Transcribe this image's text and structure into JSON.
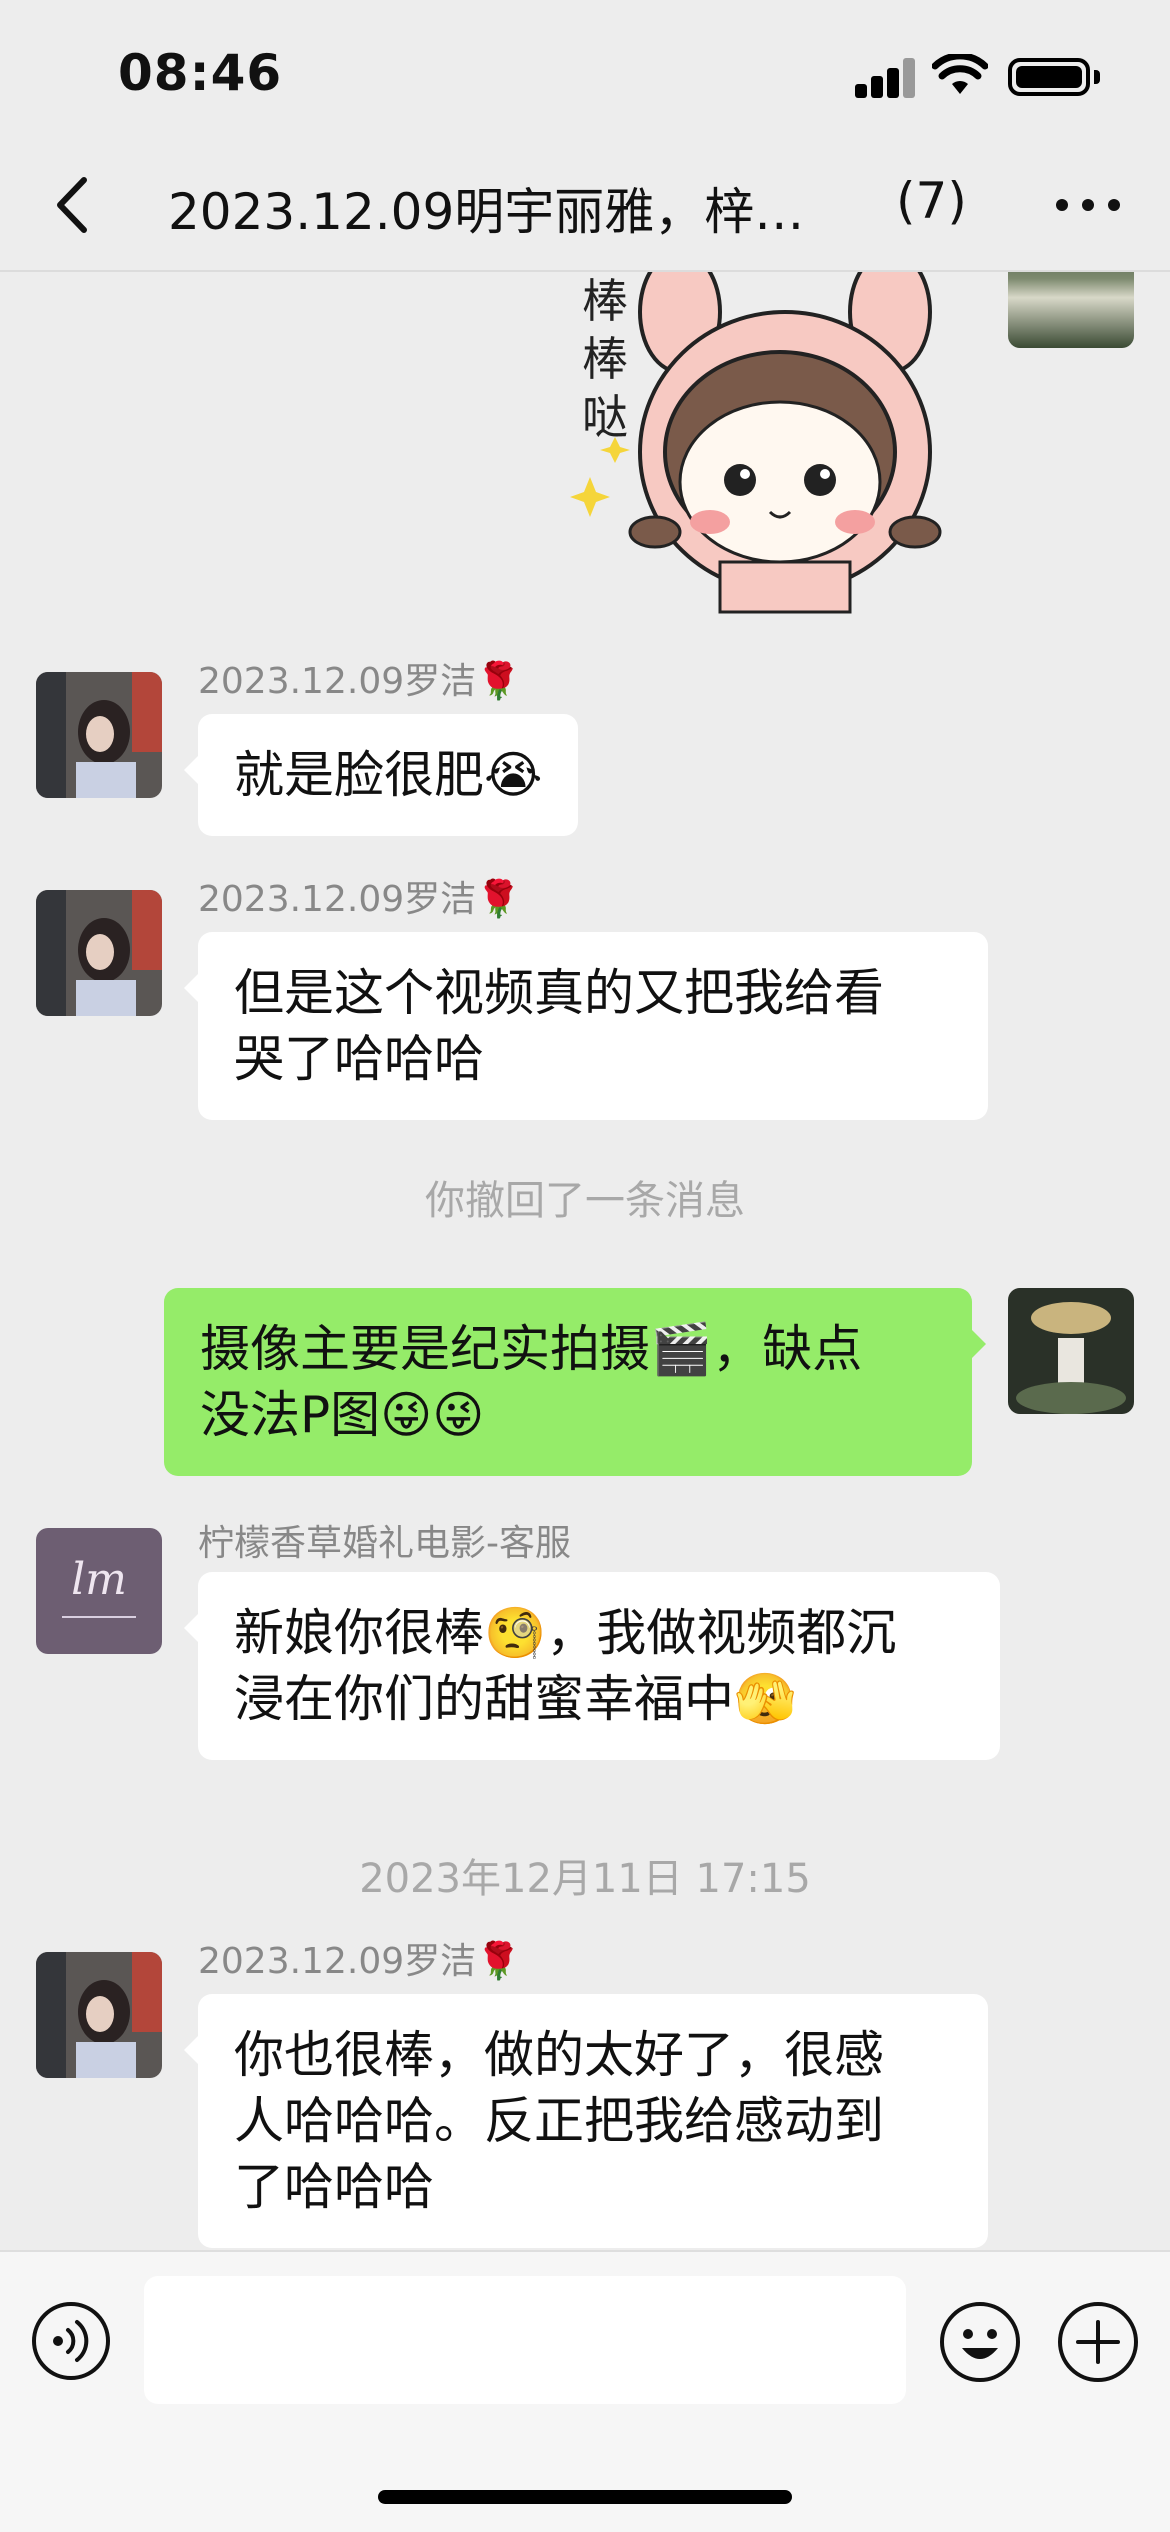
{
  "status_bar": {
    "time": "08:46"
  },
  "nav": {
    "title": "2023.12.09明宇丽雅，梓…",
    "member_count": "(7)"
  },
  "sticker": {
    "text": "棒棒哒"
  },
  "messages": [
    {
      "sender": "2023.12.09罗洁🌹",
      "lines": [
        "就是脸很肥😭"
      ]
    },
    {
      "sender": "2023.12.09罗洁🌹",
      "lines": [
        "但是这个视频真的又把我给看",
        "哭了哈哈哈"
      ]
    },
    {
      "system": "你撤回了一条消息"
    },
    {
      "sender": "",
      "lines": [
        "摄像主要是纪实拍摄🎬，缺点",
        "没法P图😜😜"
      ]
    },
    {
      "sender": "柠檬香草婚礼电影-客服",
      "lines": [
        "新娘你很棒🧐，我做视频都沉",
        "浸在你们的甜蜜幸福中🫣"
      ]
    },
    {
      "system": "2023年12月11日 17:15"
    },
    {
      "sender": "2023.12.09罗洁🌹",
      "lines": [
        "你也很棒，做的太好了，很感",
        "人哈哈哈。反正把我给感动到",
        "了哈哈哈"
      ]
    }
  ],
  "avatars": {
    "service_logo_text": "lm"
  },
  "colors": {
    "background": "#ededed",
    "self_bubble": "#95ec69",
    "other_bubble": "#ffffff"
  }
}
